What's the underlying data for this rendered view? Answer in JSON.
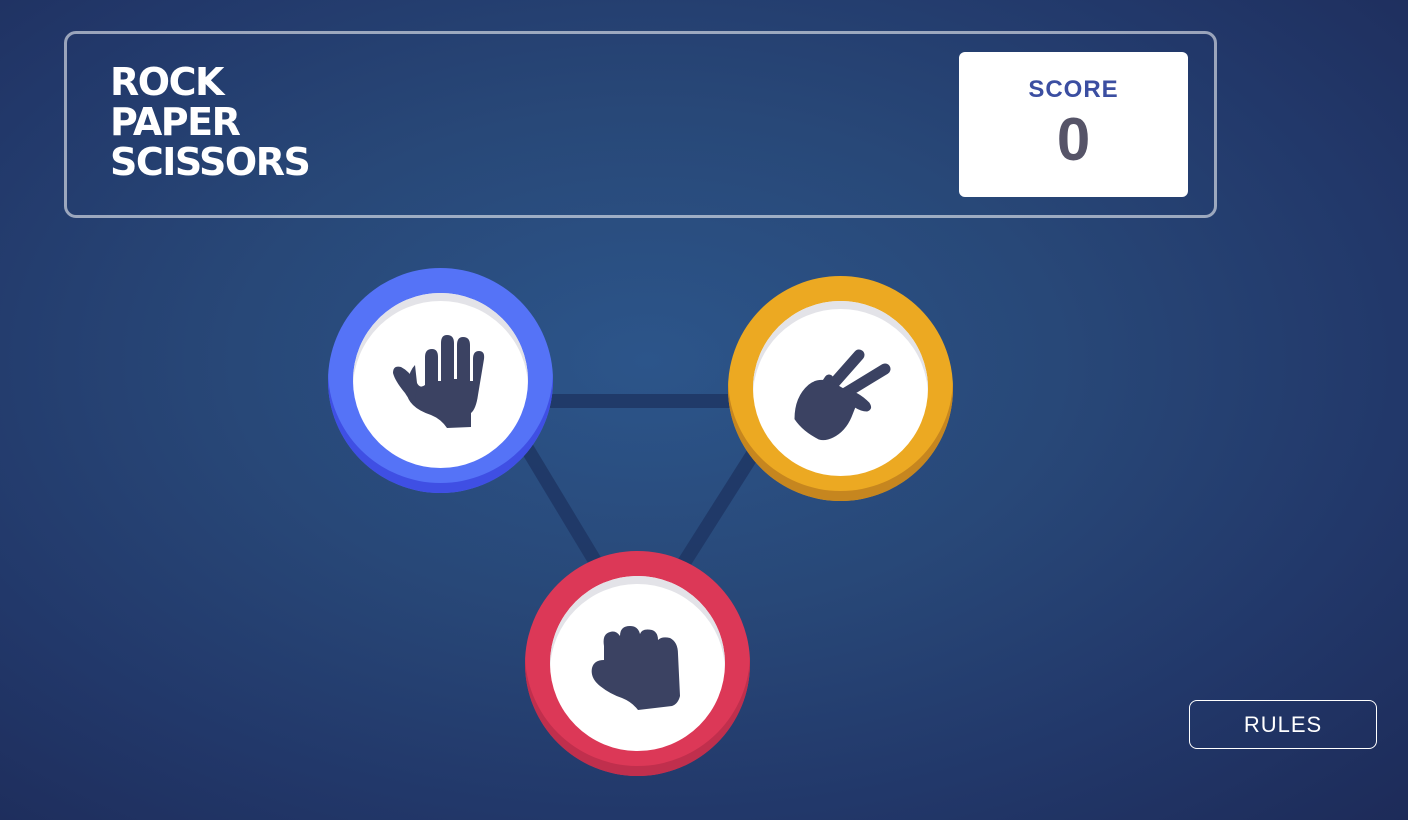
{
  "header": {
    "title_lines": [
      "ROCK",
      "PAPER",
      "SCISSORS"
    ],
    "score_label": "SCORE",
    "score_value": "0"
  },
  "tokens": [
    {
      "id": "paper",
      "icon": "paper-hand-icon",
      "color": "#5573f7"
    },
    {
      "id": "scissors",
      "icon": "scissors-hand-icon",
      "color": "#eca922"
    },
    {
      "id": "rock",
      "icon": "rock-fist-icon",
      "color": "#dc3857"
    }
  ],
  "colors": {
    "background": "#284878",
    "score_label": "#3b4ea1",
    "score_value": "#565468",
    "hand_icon": "#3b4262"
  },
  "buttons": {
    "rules_label": "RULES"
  }
}
